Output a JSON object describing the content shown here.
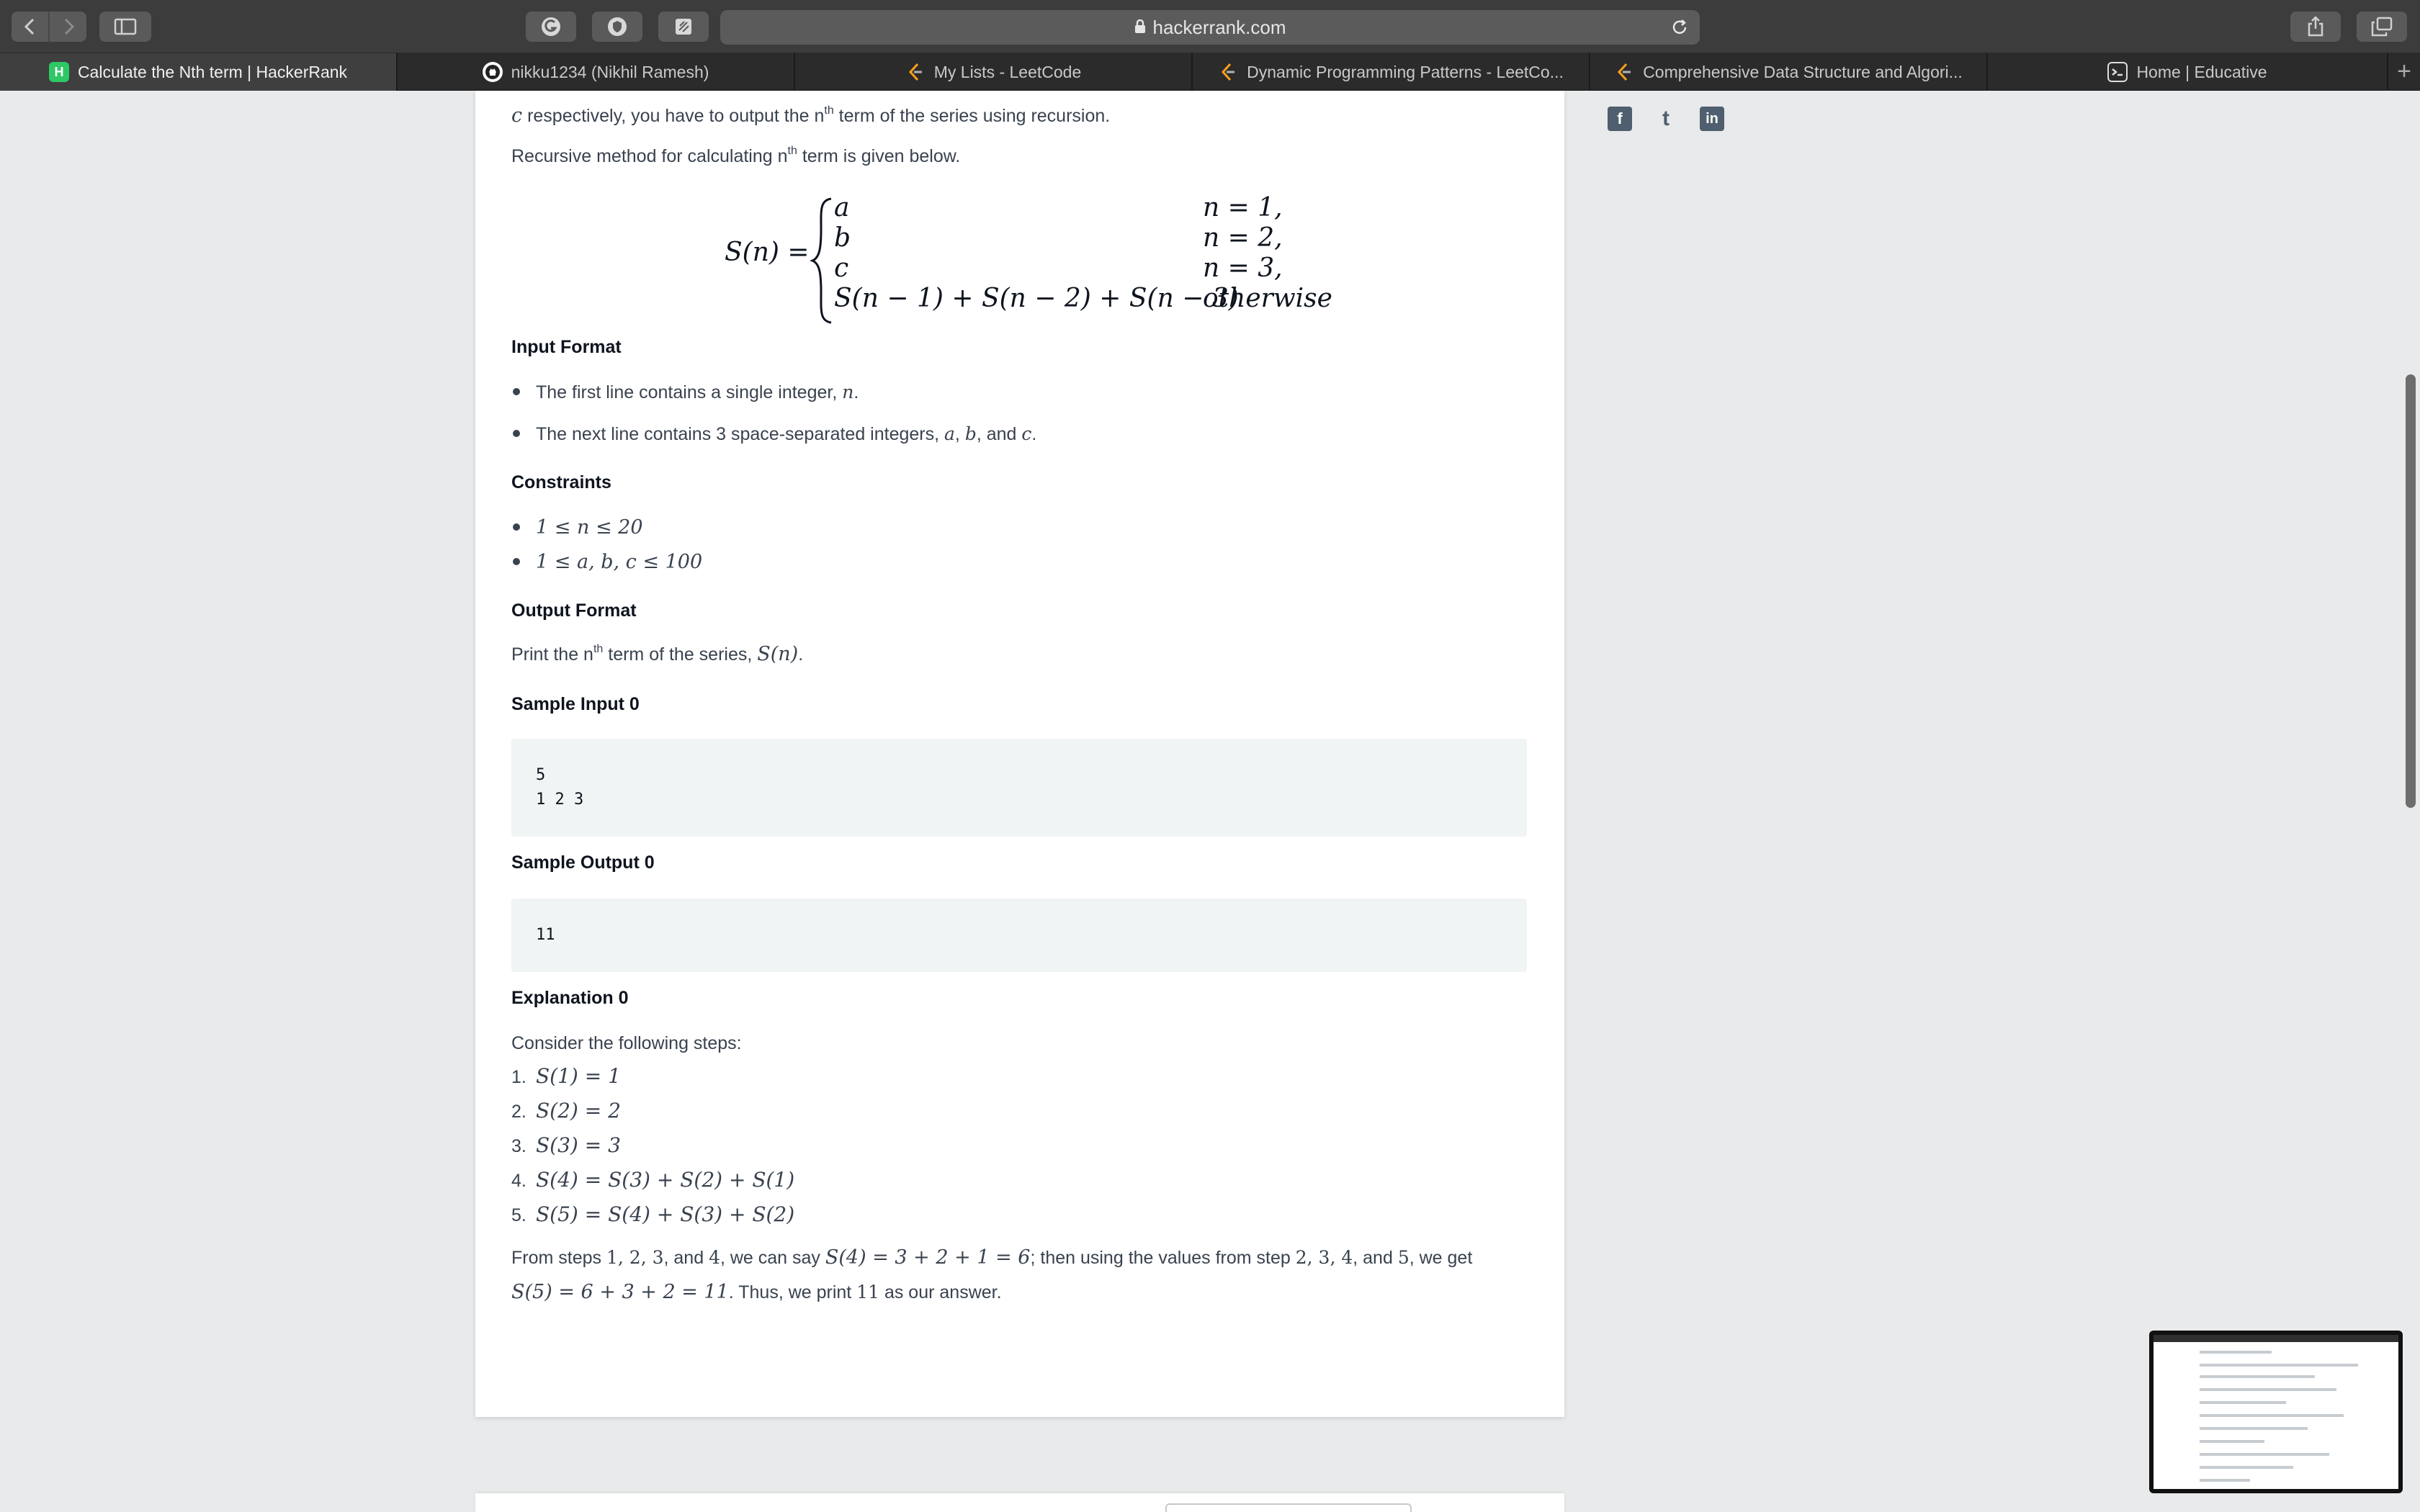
{
  "browser": {
    "url": "hackerrank.com",
    "tabs": [
      {
        "label": "Calculate the Nth term | HackerRank",
        "icon": "hackerrank-icon",
        "active": true
      },
      {
        "label": "nikku1234 (Nikhil Ramesh)",
        "icon": "github-icon",
        "active": false
      },
      {
        "label": "My Lists - LeetCode",
        "icon": "leetcode-icon",
        "active": false
      },
      {
        "label": "Dynamic Programming Patterns - LeetCo...",
        "icon": "leetcode-icon",
        "active": false
      },
      {
        "label": "Comprehensive Data Structure and Algori...",
        "icon": "leetcode-icon",
        "active": false
      },
      {
        "label": "Home | Educative",
        "icon": "educative-icon",
        "active": false
      }
    ]
  },
  "problem": {
    "intro_var": "c",
    "intro_a": " respectively, you have to output the n",
    "intro_sup": "th",
    "intro_b": " term of the series using recursion.",
    "recursive_a": "Recursive method for calculating n",
    "recursive_sup": "th",
    "recursive_b": " term is given below.",
    "formula": {
      "lhs": "S(n) =",
      "cases": [
        {
          "value": "a",
          "condition": "n = 1,"
        },
        {
          "value": "b",
          "condition": "n = 2,"
        },
        {
          "value": "c",
          "condition": "n = 3,"
        },
        {
          "value": "S(n − 1) + S(n − 2) + S(n − 3)",
          "condition": "otherwise"
        }
      ]
    },
    "input_format": {
      "heading": "Input Format",
      "line1_text": "The first line contains a single integer, ",
      "line1_var": "n",
      "line1_end": ".",
      "line2_text": "The next line contains 3 space-separated integers, ",
      "line2_a": "a",
      "line2_sep1": ", ",
      "line2_b": "b",
      "line2_sep2": ", and ",
      "line2_c": "c",
      "line2_end": "."
    },
    "constraints": {
      "heading": "Constraints",
      "items": [
        "1 ≤ n ≤ 20",
        "1 ≤ a, b, c ≤ 100"
      ]
    },
    "output_format": {
      "heading": "Output Format",
      "text_a": "Print the n",
      "text_sup": "th",
      "text_b": " term of the series, ",
      "text_var": "S(n)",
      "text_end": "."
    },
    "sample_input": {
      "heading": "Sample Input 0",
      "lines": [
        "5",
        "1 2 3"
      ]
    },
    "sample_output": {
      "heading": "Sample Output 0",
      "lines": [
        "11"
      ]
    },
    "explanation": {
      "heading": "Explanation 0",
      "intro": "Consider the following steps:",
      "steps": [
        {
          "n": "1.",
          "expr": "S(1) = 1"
        },
        {
          "n": "2.",
          "expr": "S(2) = 2"
        },
        {
          "n": "3.",
          "expr": "S(3) = 3"
        },
        {
          "n": "4.",
          "expr": "S(4) = S(3) + S(2) + S(1)"
        },
        {
          "n": "5.",
          "expr": "S(5) = S(4) + S(3) + S(2)"
        }
      ],
      "conclusion_l1_a": "From steps ",
      "conclusion_l1_steps": "1, 2, 3",
      "conclusion_l1_b": ", and ",
      "conclusion_l1_step4": "4",
      "conclusion_l1_c": ", we can say ",
      "conclusion_l1_expr": "S(4) = 3 + 2 + 1 = 6",
      "conclusion_l1_d": "; then using the values from step ",
      "conclusion_l1_steps2": "2, 3, 4",
      "conclusion_l1_e": ", and ",
      "conclusion_l1_step5": "5",
      "conclusion_l1_f": ", we get",
      "conclusion_l2_expr": "S(5) = 6 + 3 + 2 = 11",
      "conclusion_l2_a": ". Thus, we print ",
      "conclusion_l2_val": "11",
      "conclusion_l2_b": " as our answer."
    }
  },
  "social": {
    "icons": [
      "facebook-icon",
      "twitter-icon",
      "linkedin-icon"
    ],
    "labels": [
      "f",
      "t",
      "in"
    ]
  }
}
